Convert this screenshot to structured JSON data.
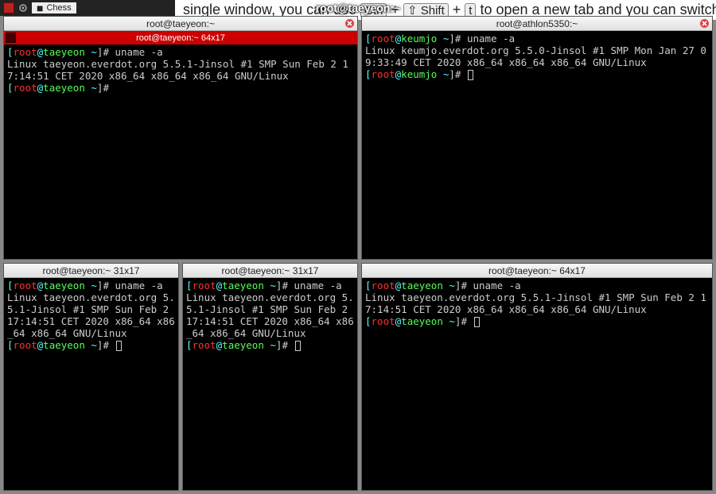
{
  "desktop": {
    "center_title": "root@taeyeon:~",
    "bg_text_prefix": "single window, you can use ",
    "bg_key1": "Ctrl",
    "bg_plus1": " + ",
    "bg_key2": "⇧ Shift",
    "bg_plus2": " + ",
    "bg_key3": "t",
    "bg_text_suffix": " to open a new tab and you can switch betw"
  },
  "taskbar": {
    "item1": "Chess"
  },
  "terminals": {
    "top_left": {
      "title": "root@taeyeon:~",
      "tab_label": "root@taeyeon:~ 64x17",
      "prompt_user": "root",
      "prompt_at": "@",
      "prompt_host": "taeyeon",
      "prompt_path": " ~",
      "prompt_end": "]# ",
      "bracket_open": "[",
      "cmd1": "uname -a",
      "out1": "Linux taeyeon.everdot.org 5.5.1-Jinsol #1 SMP Sun Feb 2 17:14:51 CET 2020 x86_64 x86_64 x86_64 GNU/Linux"
    },
    "top_right": {
      "title": "root@athlon5350:~",
      "prompt_user": "root",
      "prompt_at": "@",
      "prompt_host": "keumjo",
      "prompt_path": " ~",
      "prompt_end": "]# ",
      "bracket_open": "[",
      "cmd1": "uname -a",
      "out1": "Linux keumjo.everdot.org 5.5.0-Jinsol #1 SMP Mon Jan 27 09:33:49 CET 2020 x86_64 x86_64 x86_64 GNU/Linux"
    },
    "bot_left": {
      "title": "root@taeyeon:~ 31x17",
      "prompt_user": "root",
      "prompt_at": "@",
      "prompt_host": "taeyeon",
      "prompt_path": " ~",
      "prompt_end": "]# ",
      "bracket_open": "[",
      "cmd1": "uname -a",
      "out1": "Linux taeyeon.everdot.org 5.5.1-Jinsol #1 SMP Sun Feb 2 17:14:51 CET 2020 x86_64 x86_64 x86_64 GNU/Linux"
    },
    "bot_mid": {
      "title": "root@taeyeon:~ 31x17",
      "prompt_user": "root",
      "prompt_at": "@",
      "prompt_host": "taeyeon",
      "prompt_path": " ~",
      "prompt_end": "]# ",
      "bracket_open": "[",
      "cmd1": "uname -a",
      "out1": "Linux taeyeon.everdot.org 5.5.1-Jinsol #1 SMP Sun Feb 2 17:14:51 CET 2020 x86_64 x86_64 x86_64 GNU/Linux"
    },
    "bot_right": {
      "title": "root@taeyeon:~ 64x17",
      "prompt_user": "root",
      "prompt_at": "@",
      "prompt_host": "taeyeon",
      "prompt_path": " ~",
      "prompt_end": "]# ",
      "bracket_open": "[",
      "cmd1": "uname -a",
      "out1": "Linux taeyeon.everdot.org 5.5.1-Jinsol #1 SMP Sun Feb 2 17:14:51 CET 2020 x86_64 x86_64 x86_64 GNU/Linux"
    }
  }
}
